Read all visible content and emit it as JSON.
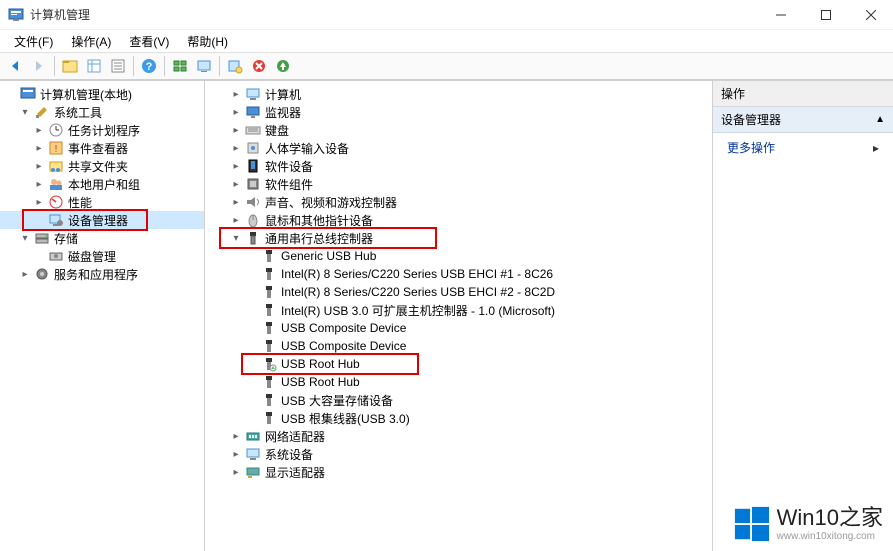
{
  "window": {
    "title": "计算机管理"
  },
  "menu": {
    "file": "文件(F)",
    "action": "操作(A)",
    "view": "查看(V)",
    "help": "帮助(H)"
  },
  "toolbar": {
    "back": "后退",
    "forward": "前进",
    "up": "上移",
    "folder": "显示/隐藏控制台树",
    "props": "属性",
    "export": "导出列表",
    "help": "帮助",
    "tile": "平铺",
    "show": "显示",
    "scan": "扫描硬件改动",
    "uninstall": "卸载",
    "update": "更新驱动"
  },
  "left": {
    "root": "计算机管理(本地)",
    "sys_tools": "系统工具",
    "task_sched": "任务计划程序",
    "event_viewer": "事件查看器",
    "shared": "共享文件夹",
    "local_users": "本地用户和组",
    "perf": "性能",
    "dev_mgr": "设备管理器",
    "storage": "存储",
    "disk_mgmt": "磁盘管理",
    "services": "服务和应用程序"
  },
  "devices": {
    "computer": "计算机",
    "monitor": "监视器",
    "keyboard": "键盘",
    "hid": "人体学输入设备",
    "software": "软件设备",
    "components": "软件组件",
    "sound": "声音、视频和游戏控制器",
    "mouse": "鼠标和其他指针设备",
    "usb_ctrl": "通用串行总线控制器",
    "usb": {
      "generic": "Generic USB Hub",
      "intel1": "Intel(R) 8 Series/C220 Series USB EHCI #1 - 8C26",
      "intel2": "Intel(R) 8 Series/C220 Series USB EHCI #2 - 8C2D",
      "intel3": "Intel(R) USB 3.0 可扩展主机控制器 - 1.0 (Microsoft)",
      "comp1": "USB Composite Device",
      "comp2": "USB Composite Device",
      "root1": "USB Root Hub",
      "root2": "USB Root Hub",
      "mass": "USB 大容量存储设备",
      "hub30": "USB 根集线器(USB 3.0)"
    },
    "network": "网络适配器",
    "system": "系统设备",
    "display": "显示适配器"
  },
  "actions": {
    "header": "操作",
    "sub": "设备管理器",
    "more": "更多操作"
  },
  "watermark": {
    "title": "Win10之家",
    "url": "www.win10xitong.com"
  }
}
